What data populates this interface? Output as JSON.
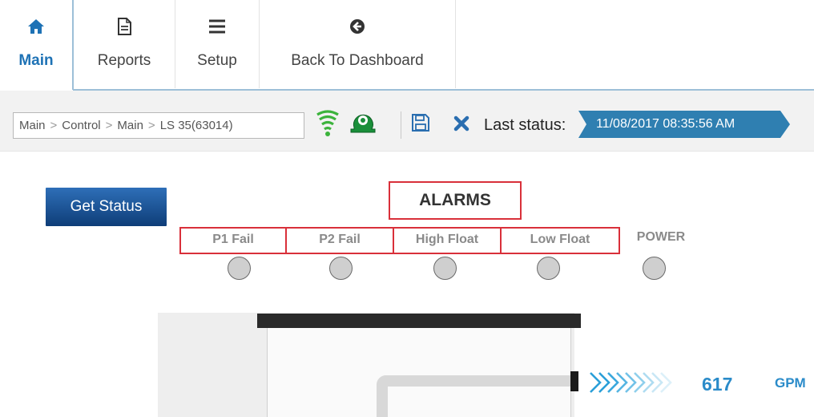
{
  "nav": {
    "tabs": [
      {
        "label": "Main",
        "icon": "home-icon",
        "active": true
      },
      {
        "label": "Reports",
        "icon": "document-icon",
        "active": false
      },
      {
        "label": "Setup",
        "icon": "menu-icon",
        "active": false
      },
      {
        "label": "Back To Dashboard",
        "icon": "back-arrow-icon",
        "active": false
      }
    ],
    "accent_color": "#1e72b5"
  },
  "toolbar": {
    "breadcrumb": [
      "Main",
      "Control",
      "Main",
      "LS 35(63014)"
    ],
    "breadcrumb_separator": ">",
    "icons": [
      "signal-icon",
      "pump-icon",
      "save-icon",
      "close-icon"
    ],
    "last_status_label": "Last status:",
    "last_status_value": "11/08/2017 08:35:56 AM",
    "status_color": "#2f7fb1"
  },
  "main": {
    "get_status_label": "Get Status",
    "alarms_title": "ALARMS",
    "alarms": [
      {
        "label": "P1 Fail",
        "boxed": true
      },
      {
        "label": "P2 Fail",
        "boxed": true
      },
      {
        "label": "High Float",
        "boxed": true
      },
      {
        "label": "Low Float",
        "boxed": true
      },
      {
        "label": "POWER",
        "boxed": false
      }
    ],
    "alarm_border_color": "#d9303a",
    "flow_value": "617",
    "flow_unit": "GPM",
    "flow_color": "#2a8bc9"
  }
}
